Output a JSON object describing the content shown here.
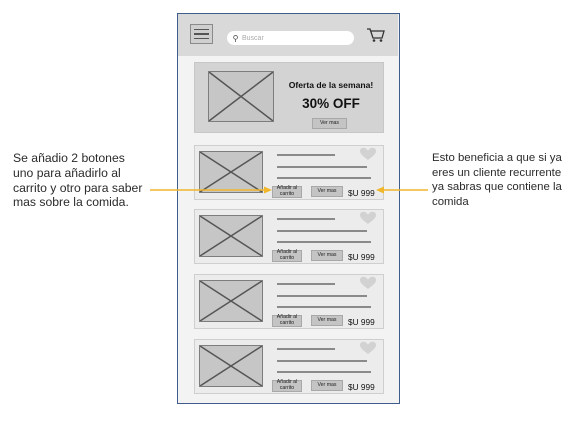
{
  "annotations": {
    "left": "Se añadio 2 botones uno para añadirlo al carrito y otro para saber mas sobre la comida.",
    "right": "Esto beneficia a que si ya eres un cliente recurrente ya sabras que contiene la comida"
  },
  "header": {
    "search_placeholder": "Buscar",
    "icons": [
      "menu-icon",
      "search-icon",
      "cart-icon"
    ]
  },
  "banner": {
    "title": "Oferta de la semana!",
    "discount": "30% OFF",
    "button_label": "Ver mas"
  },
  "products": [
    {
      "add_label": "Añadir al\ncarrito",
      "view_label": "Ver mas",
      "price": "$U 999"
    },
    {
      "add_label": "Añadir al\ncarrito",
      "view_label": "Ver mas",
      "price": "$U 999"
    },
    {
      "add_label": "Añadir al\ncarrito",
      "view_label": "Ver mas",
      "price": "$U 999"
    },
    {
      "add_label": "Añadir al\ncarrito",
      "view_label": "Ver mas",
      "price": "$U 999"
    }
  ],
  "colors": {
    "arrow": "#f0b62c",
    "frame_border": "#3f5d8c",
    "placeholder": "#c6c6c6"
  }
}
